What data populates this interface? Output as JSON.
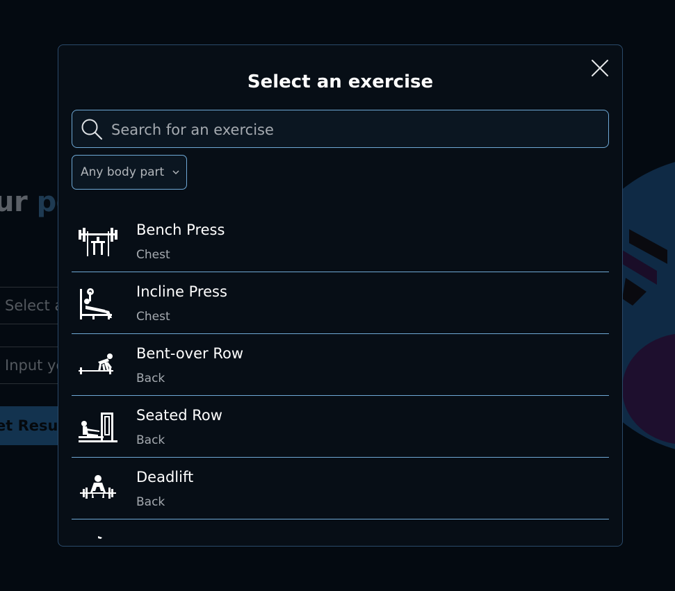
{
  "background": {
    "heading_start": "ur ",
    "heading_accent": "pov",
    "select_placeholder": "Select a",
    "input_placeholder": "Input yo",
    "button_label": "et Resul"
  },
  "modal": {
    "title": "Select an exercise",
    "close_icon": "close-x-icon",
    "search": {
      "placeholder": "Search for an exercise",
      "value": ""
    },
    "body_part_filter": {
      "selected": "Any body part"
    }
  },
  "exercises": [
    {
      "name": "Bench Press",
      "body_part": "Chest",
      "icon": "bench-press-icon"
    },
    {
      "name": "Incline Press",
      "body_part": "Chest",
      "icon": "incline-press-icon"
    },
    {
      "name": "Bent-over Row",
      "body_part": "Back",
      "icon": "bent-over-row-icon"
    },
    {
      "name": "Seated Row",
      "body_part": "Back",
      "icon": "seated-row-icon"
    },
    {
      "name": "Deadlift",
      "body_part": "Back",
      "icon": "deadlift-icon"
    },
    {
      "name": "",
      "body_part": "",
      "icon": "exercise-icon"
    }
  ],
  "colors": {
    "page_background": "#040a11",
    "modal_background": "#070e16",
    "accent_border": "#6fa9d6"
  }
}
